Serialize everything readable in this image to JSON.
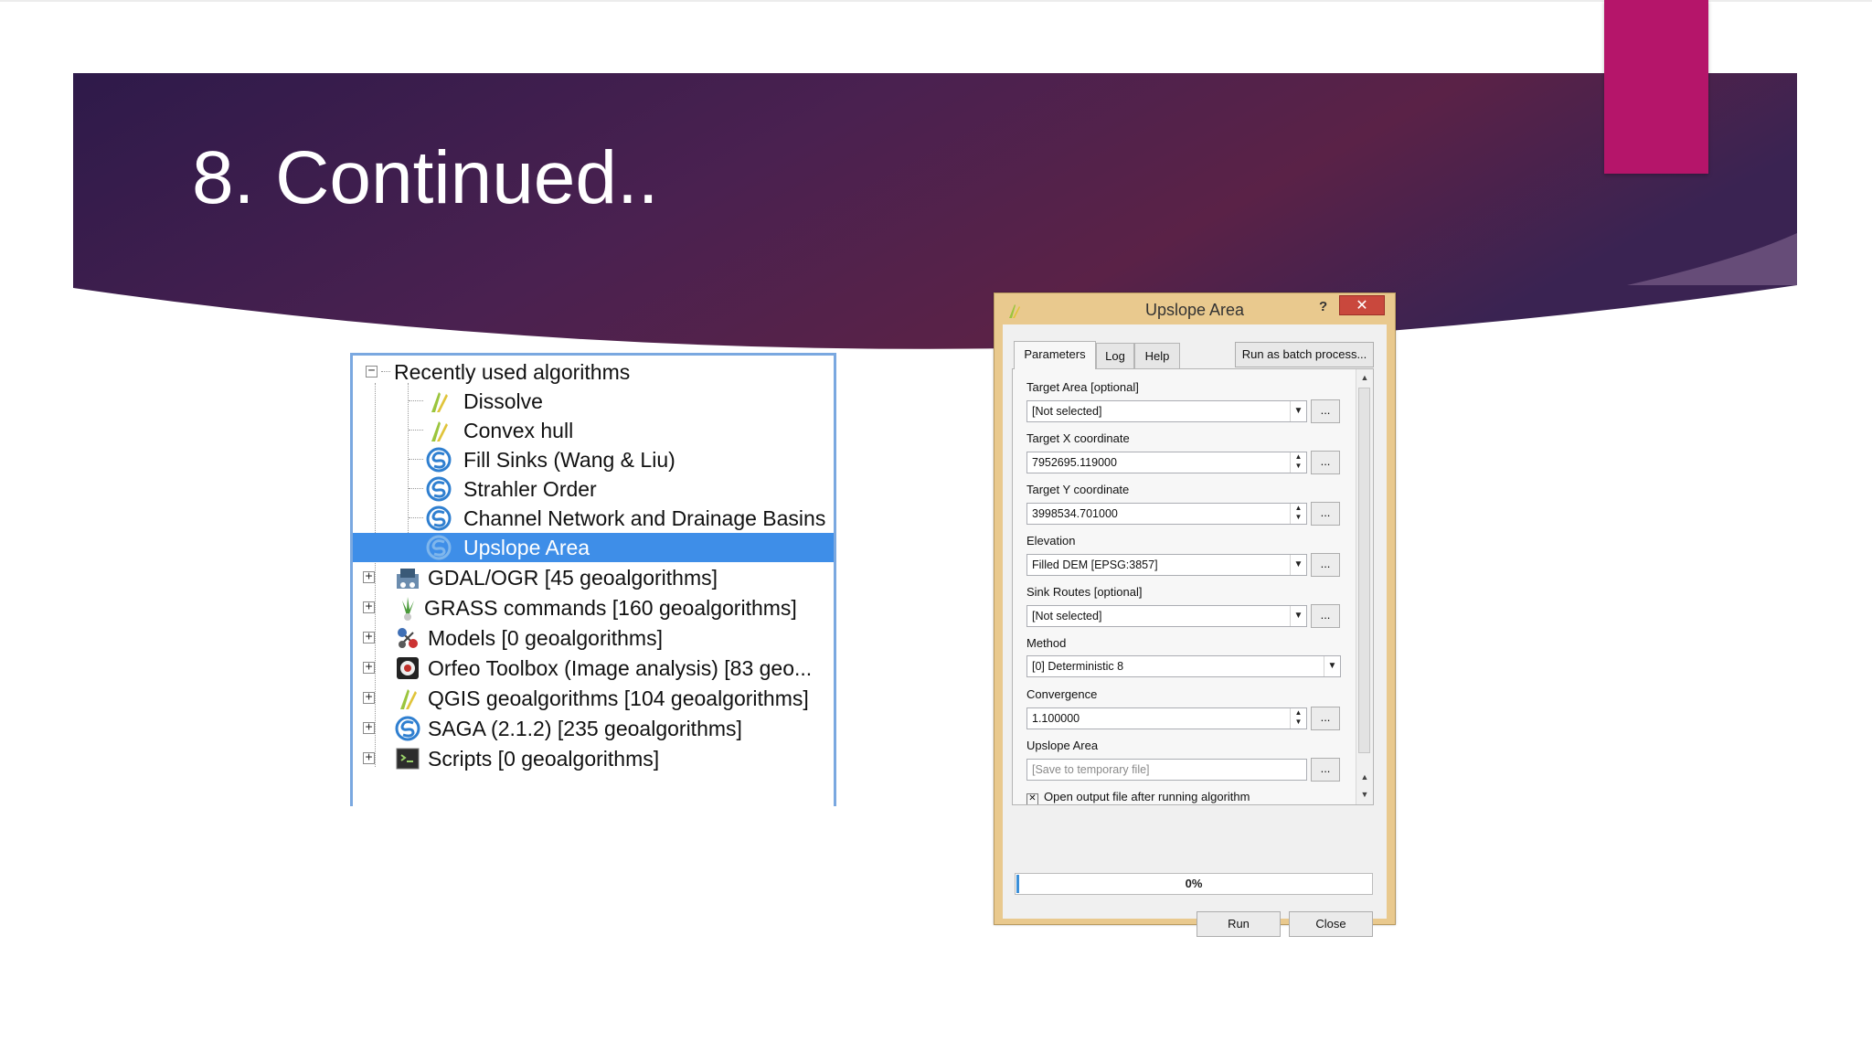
{
  "slide": {
    "title": "8. Continued..",
    "colors": {
      "banner": "#3b1d4c",
      "accent": "#b5156a"
    }
  },
  "toolbox": {
    "recent_label": "Recently used algorithms",
    "recent": [
      {
        "label": "Dissolve",
        "icon": "qgis-icon"
      },
      {
        "label": "Convex hull",
        "icon": "qgis-icon"
      },
      {
        "label": "Fill Sinks (Wang & Liu)",
        "icon": "saga-icon"
      },
      {
        "label": "Strahler Order",
        "icon": "saga-icon"
      },
      {
        "label": "Channel Network and Drainage Basins",
        "icon": "saga-icon"
      },
      {
        "label": "Upslope Area",
        "icon": "saga-icon",
        "selected": true
      }
    ],
    "providers": [
      {
        "label": "GDAL/OGR [45 geoalgorithms]",
        "icon": "gdal-icon"
      },
      {
        "label": "GRASS commands [160 geoalgorithms]",
        "icon": "grass-icon"
      },
      {
        "label": "Models [0 geoalgorithms]",
        "icon": "models-icon"
      },
      {
        "label": "Orfeo Toolbox (Image analysis) [83 geo...",
        "icon": "otb-icon"
      },
      {
        "label": "QGIS geoalgorithms [104 geoalgorithms]",
        "icon": "qgis-icon"
      },
      {
        "label": "SAGA (2.1.2) [235 geoalgorithms]",
        "icon": "saga-icon"
      },
      {
        "label": "Scripts [0 geoalgorithms]",
        "icon": "scripts-icon"
      }
    ],
    "selection_color": "#3e8ee8"
  },
  "dialog": {
    "title": "Upslope Area",
    "help_glyph": "?",
    "close_glyph": "✕",
    "tabs": [
      "Parameters",
      "Log",
      "Help"
    ],
    "batch_button": "Run as batch process...",
    "params": [
      {
        "label": "Target Area [optional]",
        "value": "[Not selected]",
        "kind": "combo"
      },
      {
        "label": "Target X coordinate",
        "value": "7952695.119000",
        "kind": "spin"
      },
      {
        "label": "Target Y coordinate",
        "value": "3998534.701000",
        "kind": "spin"
      },
      {
        "label": "Elevation",
        "value": "Filled DEM [EPSG:3857]",
        "kind": "combo"
      },
      {
        "label": "Sink Routes [optional]",
        "value": "[Not selected]",
        "kind": "combo"
      },
      {
        "label": "Method",
        "value": "[0] Deterministic 8",
        "kind": "combo-wide"
      },
      {
        "label": "Convergence",
        "value": "1.100000",
        "kind": "spin"
      },
      {
        "label": "Upslope Area",
        "value": "[Save to temporary file]",
        "kind": "output"
      }
    ],
    "dots_label": "...",
    "open_output_label": "Open output file after running algorithm",
    "open_output_checked": true,
    "progress_text": "0%",
    "progress_value": 0.0,
    "run_label": "Run",
    "close_label": "Close"
  }
}
